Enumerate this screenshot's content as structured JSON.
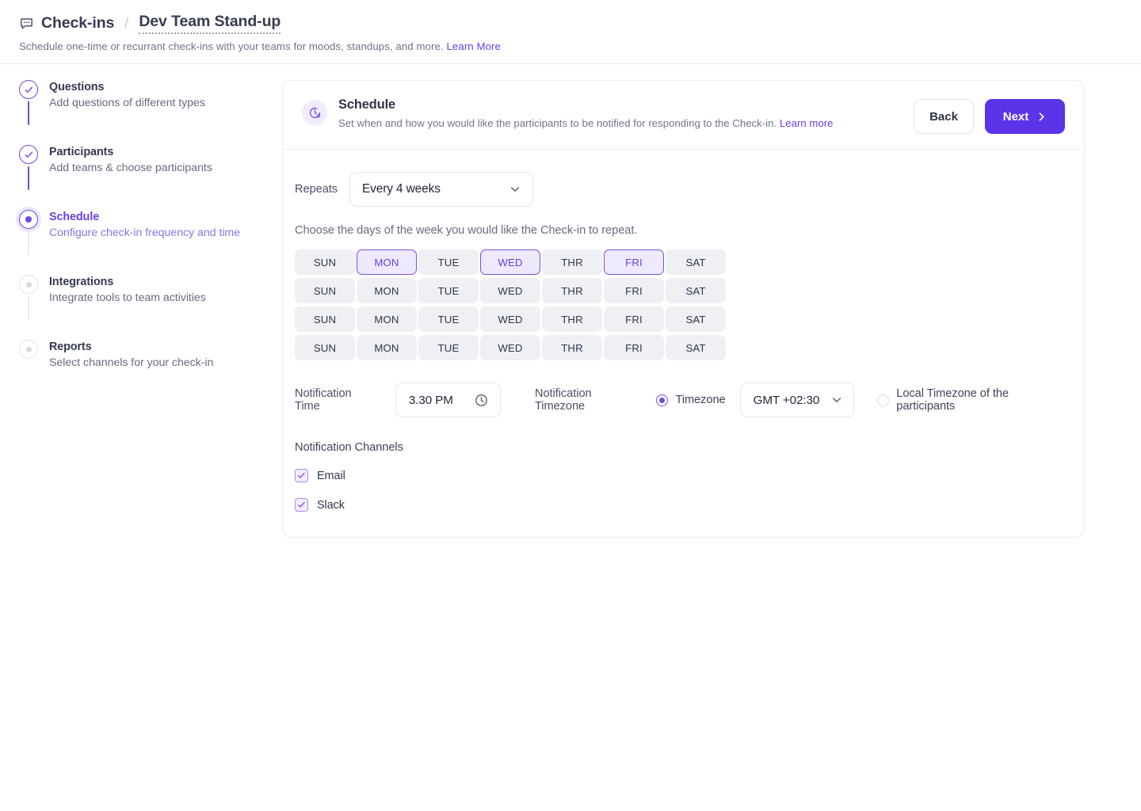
{
  "header": {
    "chat_icon": "chat-bubble-icon",
    "breadcrumb_root": "Check-ins",
    "breadcrumb_separator": "/",
    "breadcrumb_current": "Dev Team Stand-up",
    "subtitle": "Schedule one-time or recurrant check-ins with your teams for moods, standups, and more.",
    "subtitle_link": "Learn More"
  },
  "stepper": {
    "steps": [
      {
        "title": "Questions",
        "desc": "Add questions of different types",
        "state": "done"
      },
      {
        "title": "Participants",
        "desc": "Add teams & choose participants",
        "state": "done"
      },
      {
        "title": "Schedule",
        "desc": "Configure check-in frequency and time",
        "state": "active"
      },
      {
        "title": "Integrations",
        "desc": "Integrate tools to team activities",
        "state": "todo"
      },
      {
        "title": "Reports",
        "desc": "Select channels for your check-in",
        "state": "todo"
      }
    ]
  },
  "card": {
    "icon": "clock-plus-icon",
    "title": "Schedule",
    "description": "Set when and how you would like the participants to be notified for responding to the Check-in.",
    "description_link": "Learn more",
    "back_label": "Back",
    "next_label": "Next"
  },
  "form": {
    "repeats_label": "Repeats",
    "repeats_value": "Every 4 weeks",
    "days_helper": "Choose the days of the week you would like the Check-in to repeat.",
    "day_labels": [
      "SUN",
      "MON",
      "TUE",
      "WED",
      "THR",
      "FRI",
      "SAT"
    ],
    "week_rows": [
      {
        "selected": [
          "MON",
          "WED",
          "FRI"
        ]
      },
      {
        "selected": []
      },
      {
        "selected": []
      },
      {
        "selected": []
      }
    ],
    "notification_time_label": "Notification Time",
    "notification_time_value": "3.30 PM",
    "notification_time_icon": "clock-icon",
    "notification_timezone_label": "Notification Timezone",
    "timezone_radio_label": "Timezone",
    "timezone_radio_selected": true,
    "timezone_value": "GMT +02:30",
    "local_timezone_label": "Local Timezone of the participants",
    "local_timezone_selected": false,
    "channels_title": "Notification Channels",
    "channels": [
      {
        "label": "Email",
        "checked": true
      },
      {
        "label": "Slack",
        "checked": true
      }
    ]
  },
  "colors": {
    "accent": "#5b33e8",
    "accent_soft": "#efe9fe",
    "step_line": "#6d4ae0",
    "day_bg": "#eef0f4",
    "text_dark": "#2f3349",
    "text_muted": "#6e7388"
  }
}
